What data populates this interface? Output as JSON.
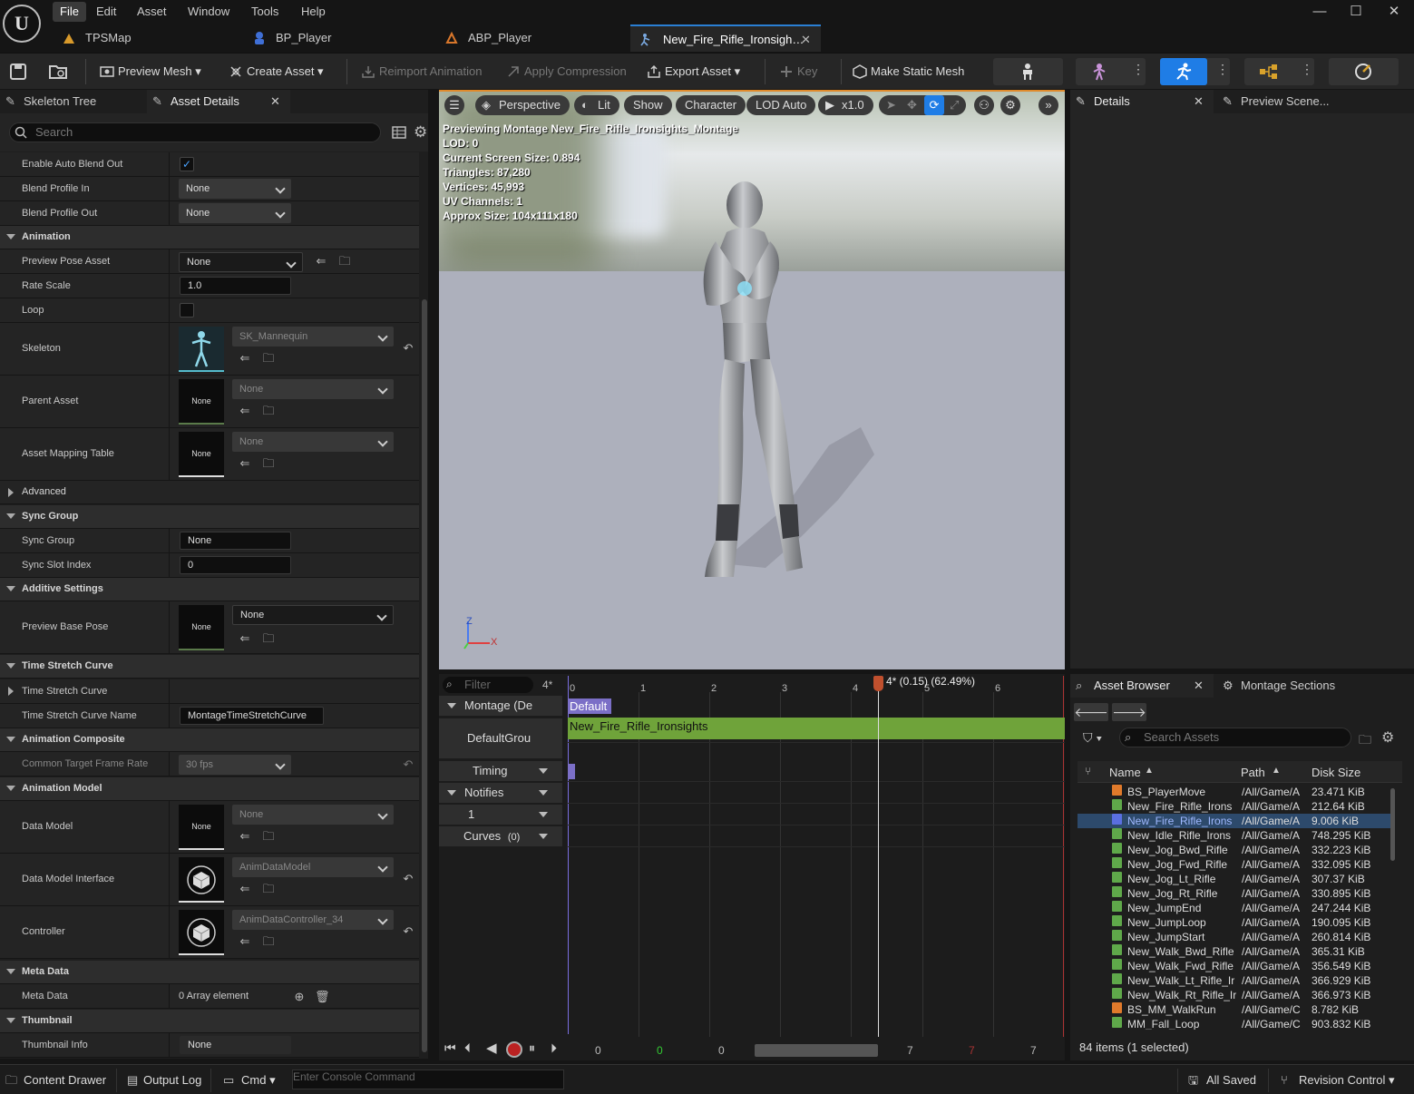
{
  "menu": [
    "File",
    "Edit",
    "Asset",
    "Window",
    "Tools",
    "Help"
  ],
  "doc_tabs": [
    "TPSMap",
    "BP_Player",
    "ABP_Player",
    "New_Fire_Rifle_Ironsigh…"
  ],
  "toolbar": {
    "preview_mesh": "Preview Mesh",
    "create_asset": "Create Asset",
    "reimport": "Reimport Animation",
    "apply_compression": "Apply Compression",
    "export_asset": "Export Asset",
    "key": "Key",
    "make_static_mesh": "Make Static Mesh"
  },
  "left_tabs": {
    "skeleton_tree": "Skeleton Tree",
    "asset_details": "Asset Details"
  },
  "search_placeholder": "Search",
  "props": {
    "enable_auto_blend_out": "Enable Auto Blend Out",
    "blend_profile_in": "Blend Profile In",
    "blend_profile_in_val": "None",
    "blend_profile_out": "Blend Profile Out",
    "blend_profile_out_val": "None",
    "cat_animation": "Animation",
    "preview_pose_asset": "Preview Pose Asset",
    "preview_pose_asset_val": "None",
    "rate_scale": "Rate Scale",
    "rate_scale_val": "1.0",
    "loop": "Loop",
    "skeleton": "Skeleton",
    "skeleton_val": "SK_Mannequin",
    "parent_asset": "Parent Asset",
    "parent_asset_val": "None",
    "asset_mapping_table": "Asset Mapping Table",
    "asset_mapping_table_val": "None",
    "thumb_none": "None",
    "advanced": "Advanced",
    "cat_sync_group": "Sync Group",
    "sync_group": "Sync Group",
    "sync_group_val": "None",
    "sync_slot_index": "Sync Slot Index",
    "sync_slot_index_val": "0",
    "cat_additive": "Additive Settings",
    "preview_base_pose": "Preview Base Pose",
    "preview_base_pose_val": "None",
    "cat_time_stretch": "Time Stretch Curve",
    "time_stretch_curve": "Time Stretch Curve",
    "time_stretch_curve_name": "Time Stretch Curve Name",
    "time_stretch_curve_name_val": "MontageTimeStretchCurve",
    "cat_anim_composite": "Animation Composite",
    "common_target_frame_rate": "Common Target Frame Rate",
    "common_target_frame_rate_val": "30 fps",
    "cat_anim_model": "Animation Model",
    "data_model": "Data Model",
    "data_model_val": "None",
    "data_model_interface": "Data Model Interface",
    "data_model_interface_val": "AnimDataModel",
    "controller": "Controller",
    "controller_val": "AnimDataController_34",
    "cat_meta_data": "Meta Data",
    "meta_data": "Meta Data",
    "meta_data_val": "0 Array element",
    "cat_thumbnail": "Thumbnail",
    "thumbnail_info": "Thumbnail Info",
    "thumbnail_info_val": "None"
  },
  "viewport": {
    "perspective": "Perspective",
    "lit": "Lit",
    "show": "Show",
    "character": "Character",
    "lod": "LOD Auto",
    "speed": "x1.0",
    "stats": [
      "Previewing Montage New_Fire_Rifle_Ironsights_Montage",
      "LOD: 0",
      "Current Screen Size: 0.894",
      "Triangles: 87,280",
      "Vertices: 45,993",
      "UV Channels: 1",
      "Approx Size: 104x111x180"
    ],
    "axis_z": "Z",
    "axis_x": "X"
  },
  "right_tabs": {
    "details": "Details",
    "preview_scene": "Preview Scene..."
  },
  "timeline": {
    "filter_placeholder": "Filter",
    "frame_badge": "4*",
    "playhead_label": "4* (0.15) (62.49%)",
    "ticks": [
      "0",
      "1",
      "2",
      "3",
      "4",
      "5",
      "6"
    ],
    "montage": "Montage (De",
    "default_section": "Default",
    "default_group": "DefaultGrou",
    "segment": "New_Fire_Rifle_Ironsights",
    "timing": "Timing",
    "notifies": "Notifies",
    "notify_track": "1",
    "curves": "Curves",
    "curves_count": "(0)",
    "bottom_nums": [
      "0",
      "0",
      "0",
      "7",
      "7",
      "7"
    ]
  },
  "browser": {
    "tab_asset_browser": "Asset Browser",
    "tab_montage_sections": "Montage Sections",
    "search_placeholder": "Search Assets",
    "col_name": "Name",
    "col_path": "Path",
    "col_size": "Disk Size",
    "rows": [
      {
        "name": "BS_PlayerMove",
        "path": "/All/Game/A",
        "size": "23.471 KiB",
        "kind": "blendspace"
      },
      {
        "name": "New_Fire_Rifle_Irons",
        "path": "/All/Game/A",
        "size": "212.64 KiB",
        "kind": "anim"
      },
      {
        "name": "New_Fire_Rifle_Irons",
        "path": "/All/Game/A",
        "size": "9.006 KiB",
        "kind": "montage"
      },
      {
        "name": "New_Idle_Rifle_Irons",
        "path": "/All/Game/A",
        "size": "748.295 KiB",
        "kind": "anim"
      },
      {
        "name": "New_Jog_Bwd_Rifle",
        "path": "/All/Game/A",
        "size": "332.223 KiB",
        "kind": "anim"
      },
      {
        "name": "New_Jog_Fwd_Rifle",
        "path": "/All/Game/A",
        "size": "332.095 KiB",
        "kind": "anim"
      },
      {
        "name": "New_Jog_Lt_Rifle",
        "path": "/All/Game/A",
        "size": "307.37 KiB",
        "kind": "anim"
      },
      {
        "name": "New_Jog_Rt_Rifle",
        "path": "/All/Game/A",
        "size": "330.895 KiB",
        "kind": "anim"
      },
      {
        "name": "New_JumpEnd",
        "path": "/All/Game/A",
        "size": "247.244 KiB",
        "kind": "anim"
      },
      {
        "name": "New_JumpLoop",
        "path": "/All/Game/A",
        "size": "190.095 KiB",
        "kind": "anim"
      },
      {
        "name": "New_JumpStart",
        "path": "/All/Game/A",
        "size": "260.814 KiB",
        "kind": "anim"
      },
      {
        "name": "New_Walk_Bwd_Rifle",
        "path": "/All/Game/A",
        "size": "365.31 KiB",
        "kind": "anim"
      },
      {
        "name": "New_Walk_Fwd_Rifle",
        "path": "/All/Game/A",
        "size": "356.549 KiB",
        "kind": "anim"
      },
      {
        "name": "New_Walk_Lt_Rifle_Ir",
        "path": "/All/Game/A",
        "size": "366.929 KiB",
        "kind": "anim"
      },
      {
        "name": "New_Walk_Rt_Rifle_Ir",
        "path": "/All/Game/A",
        "size": "366.973 KiB",
        "kind": "anim"
      },
      {
        "name": "BS_MM_WalkRun",
        "path": "/All/Game/C",
        "size": "8.782 KiB",
        "kind": "blendspace"
      },
      {
        "name": "MM_Fall_Loop",
        "path": "/All/Game/C",
        "size": "903.832 KiB",
        "kind": "anim"
      }
    ],
    "footer": "84 items (1 selected)"
  },
  "statusbar": {
    "content_drawer": "Content Drawer",
    "output_log": "Output Log",
    "cmd": "Cmd",
    "console_placeholder": "Enter Console Command",
    "all_saved": "All Saved",
    "revision_control": "Revision Control"
  },
  "colors": {
    "accent": "#2a7fd4",
    "segment": "#6fa33a",
    "section": "#7b6fc7",
    "playhead": "#c0502e",
    "selected_row": "#2d4a6c"
  },
  "icons": [
    "unreal-logo",
    "save-icon",
    "browse-icon",
    "preview-mesh-icon",
    "create-asset-icon",
    "reimport-icon",
    "compression-icon",
    "export-icon",
    "key-icon",
    "static-mesh-icon",
    "skeleton-mode-icon",
    "mesh-mode-icon",
    "animation-mode-icon",
    "blueprint-mode-icon",
    "physics-mode-icon",
    "search-icon",
    "table-icon",
    "gear-icon",
    "checkbox-icon",
    "reset-icon",
    "browse-asset-icon",
    "use-selected-icon",
    "add-icon",
    "trash-icon",
    "play-icon",
    "record-icon",
    "pause-icon",
    "folder-icon",
    "filter-icon"
  ]
}
